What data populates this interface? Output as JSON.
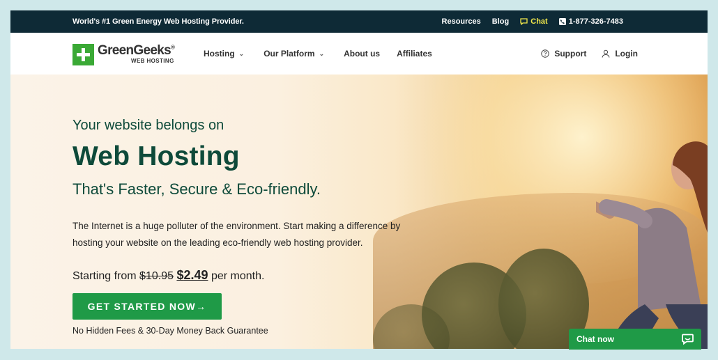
{
  "topbar": {
    "tagline": "World's #1 Green Energy Web Hosting Provider.",
    "links": {
      "resources": "Resources",
      "blog": "Blog",
      "chat": "Chat",
      "phone": "1-877-326-7483"
    }
  },
  "nav": {
    "logo_name": "GreenGeeks",
    "logo_reg": "®",
    "logo_sub": "WEB HOSTING",
    "items": [
      {
        "label": "Hosting",
        "dropdown": true
      },
      {
        "label": "Our Platform",
        "dropdown": true
      },
      {
        "label": "About us",
        "dropdown": false
      },
      {
        "label": "Affiliates",
        "dropdown": false
      }
    ],
    "support": "Support",
    "login": "Login"
  },
  "hero": {
    "eyebrow": "Your website belongs on",
    "headline": "Web Hosting",
    "subhead": "That's Faster, Secure & Eco-friendly.",
    "description": "The Internet is a huge polluter of the environment. Start making a difference by hosting your website on the leading eco-friendly web hosting provider.",
    "price_prefix": "Starting from",
    "price_old": "$10.95",
    "price_new_currency": "$",
    "price_new": "2.49",
    "price_suffix": "per month.",
    "cta_label": "GET STARTED NOW",
    "cta_arrow": "→",
    "guarantee": "No Hidden Fees & 30-Day Money Back Guarantee"
  },
  "chat_widget": {
    "label": "Chat now"
  },
  "colors": {
    "brand_green": "#3aa935",
    "cta_green": "#1f9a47",
    "topbar": "#0e2a36",
    "heading": "#0e4a3a",
    "chat_highlight": "#f2e84b"
  }
}
